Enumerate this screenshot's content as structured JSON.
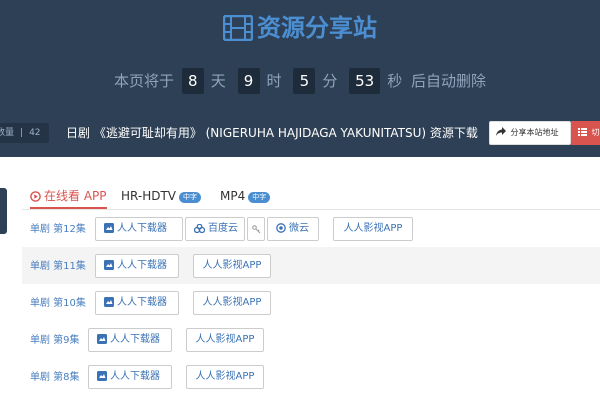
{
  "header": {
    "site_title": "资源分享站",
    "countdown": {
      "prefix": "本页将于",
      "days": "8",
      "days_unit": "天",
      "hours": "9",
      "hours_unit": "时",
      "minutes": "5",
      "minutes_unit": "分",
      "seconds": "53",
      "seconds_unit": "秒",
      "suffix": "后自动删除"
    }
  },
  "infobar": {
    "count_label": "数量",
    "count_value": "42",
    "title": "日剧 《逃避可耻却有用》 (NIGERUHA HAJIDAGA YAKUNITATSU) 资源下载",
    "share_label": "分享本站地址",
    "switch_label": "切换"
  },
  "tabs": [
    {
      "label": "在线看 APP",
      "badge": ""
    },
    {
      "label": "HR-HDTV",
      "badge": "中字"
    },
    {
      "label": "MP4",
      "badge": "中字"
    }
  ],
  "episodes": [
    {
      "label": "单剧 第12集",
      "downloader": "人人下载器",
      "baidu": "百度云",
      "weiyun": "微云",
      "app": "人人影视APP"
    },
    {
      "label": "单剧 第11集",
      "downloader": "人人下载器",
      "app": "人人影视APP"
    },
    {
      "label": "单剧 第10集",
      "downloader": "人人下载器",
      "app": "人人影视APP"
    },
    {
      "label": "单剧 第9集",
      "downloader": "人人下载器",
      "app": "人人影视APP"
    },
    {
      "label": "单剧 第8集",
      "downloader": "人人下载器",
      "app": "人人影视APP"
    }
  ],
  "colors": {
    "header_bg": "#2e4055",
    "title_blue": "#4b8ed1",
    "active_red": "#d9534f",
    "link_blue": "#3a72b5"
  },
  "icons": {
    "title": "film-icon",
    "share": "share-arrow-icon",
    "switch": "list-icon",
    "tab_active": "play-circle-icon",
    "downloader": "download-app-icon",
    "baidu": "baidu-cloud-icon",
    "key": "key-icon",
    "weiyun": "weiyun-icon"
  }
}
